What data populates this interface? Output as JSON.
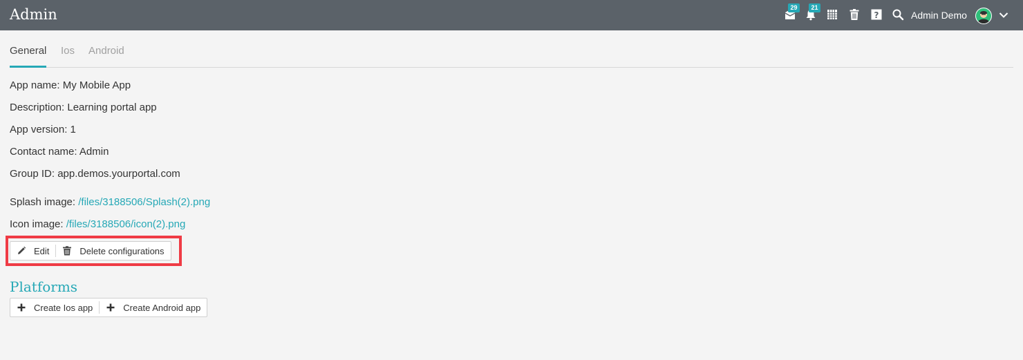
{
  "header": {
    "title": "Admin",
    "messages_badge": "29",
    "notifications_badge": "21",
    "user_name": "Admin Demo",
    "accent_color": "#26a8b6",
    "bar_color": "#5b6269"
  },
  "tabs": [
    {
      "label": "General",
      "active": true
    },
    {
      "label": "Ios",
      "active": false
    },
    {
      "label": "Android",
      "active": false
    }
  ],
  "details": {
    "app_name": "App name: My Mobile App",
    "description": "Description: Learning portal app",
    "app_version": "App version: 1",
    "contact_name": "Contact name: Admin",
    "group_id": "Group ID: app.demos.yourportal.com",
    "splash_label": "Splash image:",
    "splash_link": "/files/3188506/Splash(2).png",
    "icon_label": "Icon image:",
    "icon_link": "/files/3188506/icon(2).png"
  },
  "actions": {
    "edit_label": "Edit",
    "delete_label": "Delete configurations",
    "highlight_color": "#ef3b45"
  },
  "platforms": {
    "heading": "Platforms",
    "create_ios_label": "Create Ios app",
    "create_android_label": "Create Android app"
  }
}
